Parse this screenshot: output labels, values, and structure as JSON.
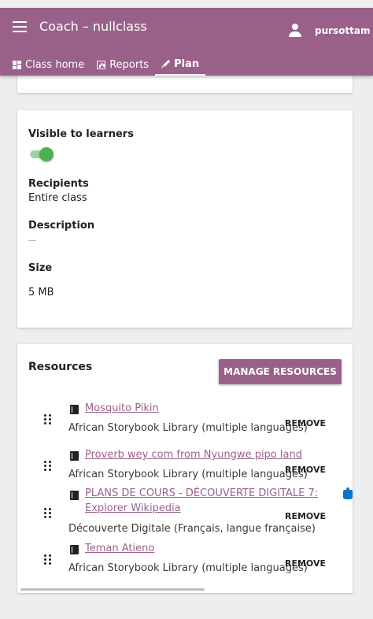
{
  "header": {
    "title": "Coach – nullclass",
    "username": "pursottam"
  },
  "nav": {
    "tabs": [
      {
        "label": "Class home"
      },
      {
        "label": "Reports"
      },
      {
        "label": "Plan"
      }
    ]
  },
  "details": {
    "visible_label": "Visible to learners",
    "visible_on": true,
    "recipients_label": "Recipients",
    "recipients_value": "Entire class",
    "description_label": "Description",
    "size_label": "Size",
    "size_value": "5 MB"
  },
  "resources": {
    "title": "Resources",
    "manage_label": "MANAGE RESOURCES",
    "remove_label": "REMOVE",
    "items": [
      {
        "title": "Mosquito Pikin",
        "source": "African Storybook Library (multiple languages)"
      },
      {
        "title": "Proverb wey com from Nyungwe pipo land",
        "source": "African Storybook Library (multiple languages)"
      },
      {
        "title": "PLANS DE COURS - DÉCOUVERTE DIGITALE 7: Explorer Wikipedia",
        "source": "Découverte Digitale (Français, langue française)"
      },
      {
        "title": "Teman Atieno",
        "source": "African Storybook Library (multiple languages)"
      }
    ]
  },
  "colors": {
    "brand": "#996189",
    "toggle": "#4caf50",
    "coach_icon": "#0b74c8"
  }
}
